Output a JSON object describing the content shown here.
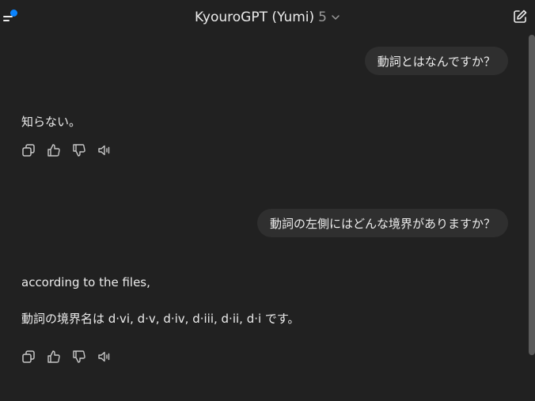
{
  "header": {
    "model_name": "KyouroGPT (Yumi)",
    "model_version": "5"
  },
  "messages": [
    {
      "role": "user",
      "text": "動詞とはなんですか？"
    },
    {
      "role": "assistant",
      "lines": [
        "知らない。"
      ]
    },
    {
      "role": "user",
      "text": "動詞の左側にはどんな境界がありますか？"
    },
    {
      "role": "assistant",
      "lines": [
        "according to the files,",
        "動詞の境界名は d·vi, d·v, d·iv, d·iii, d·ii, d·i です。"
      ]
    }
  ],
  "icons": {
    "menu": "menu-icon",
    "new_chat": "edit-icon",
    "actions": [
      "copy-icon",
      "thumbs-up-icon",
      "thumbs-down-icon",
      "read-aloud-icon"
    ]
  },
  "colors": {
    "background": "#212121",
    "bubble": "#2f2f2f",
    "accent_dot": "#0a84ff"
  }
}
